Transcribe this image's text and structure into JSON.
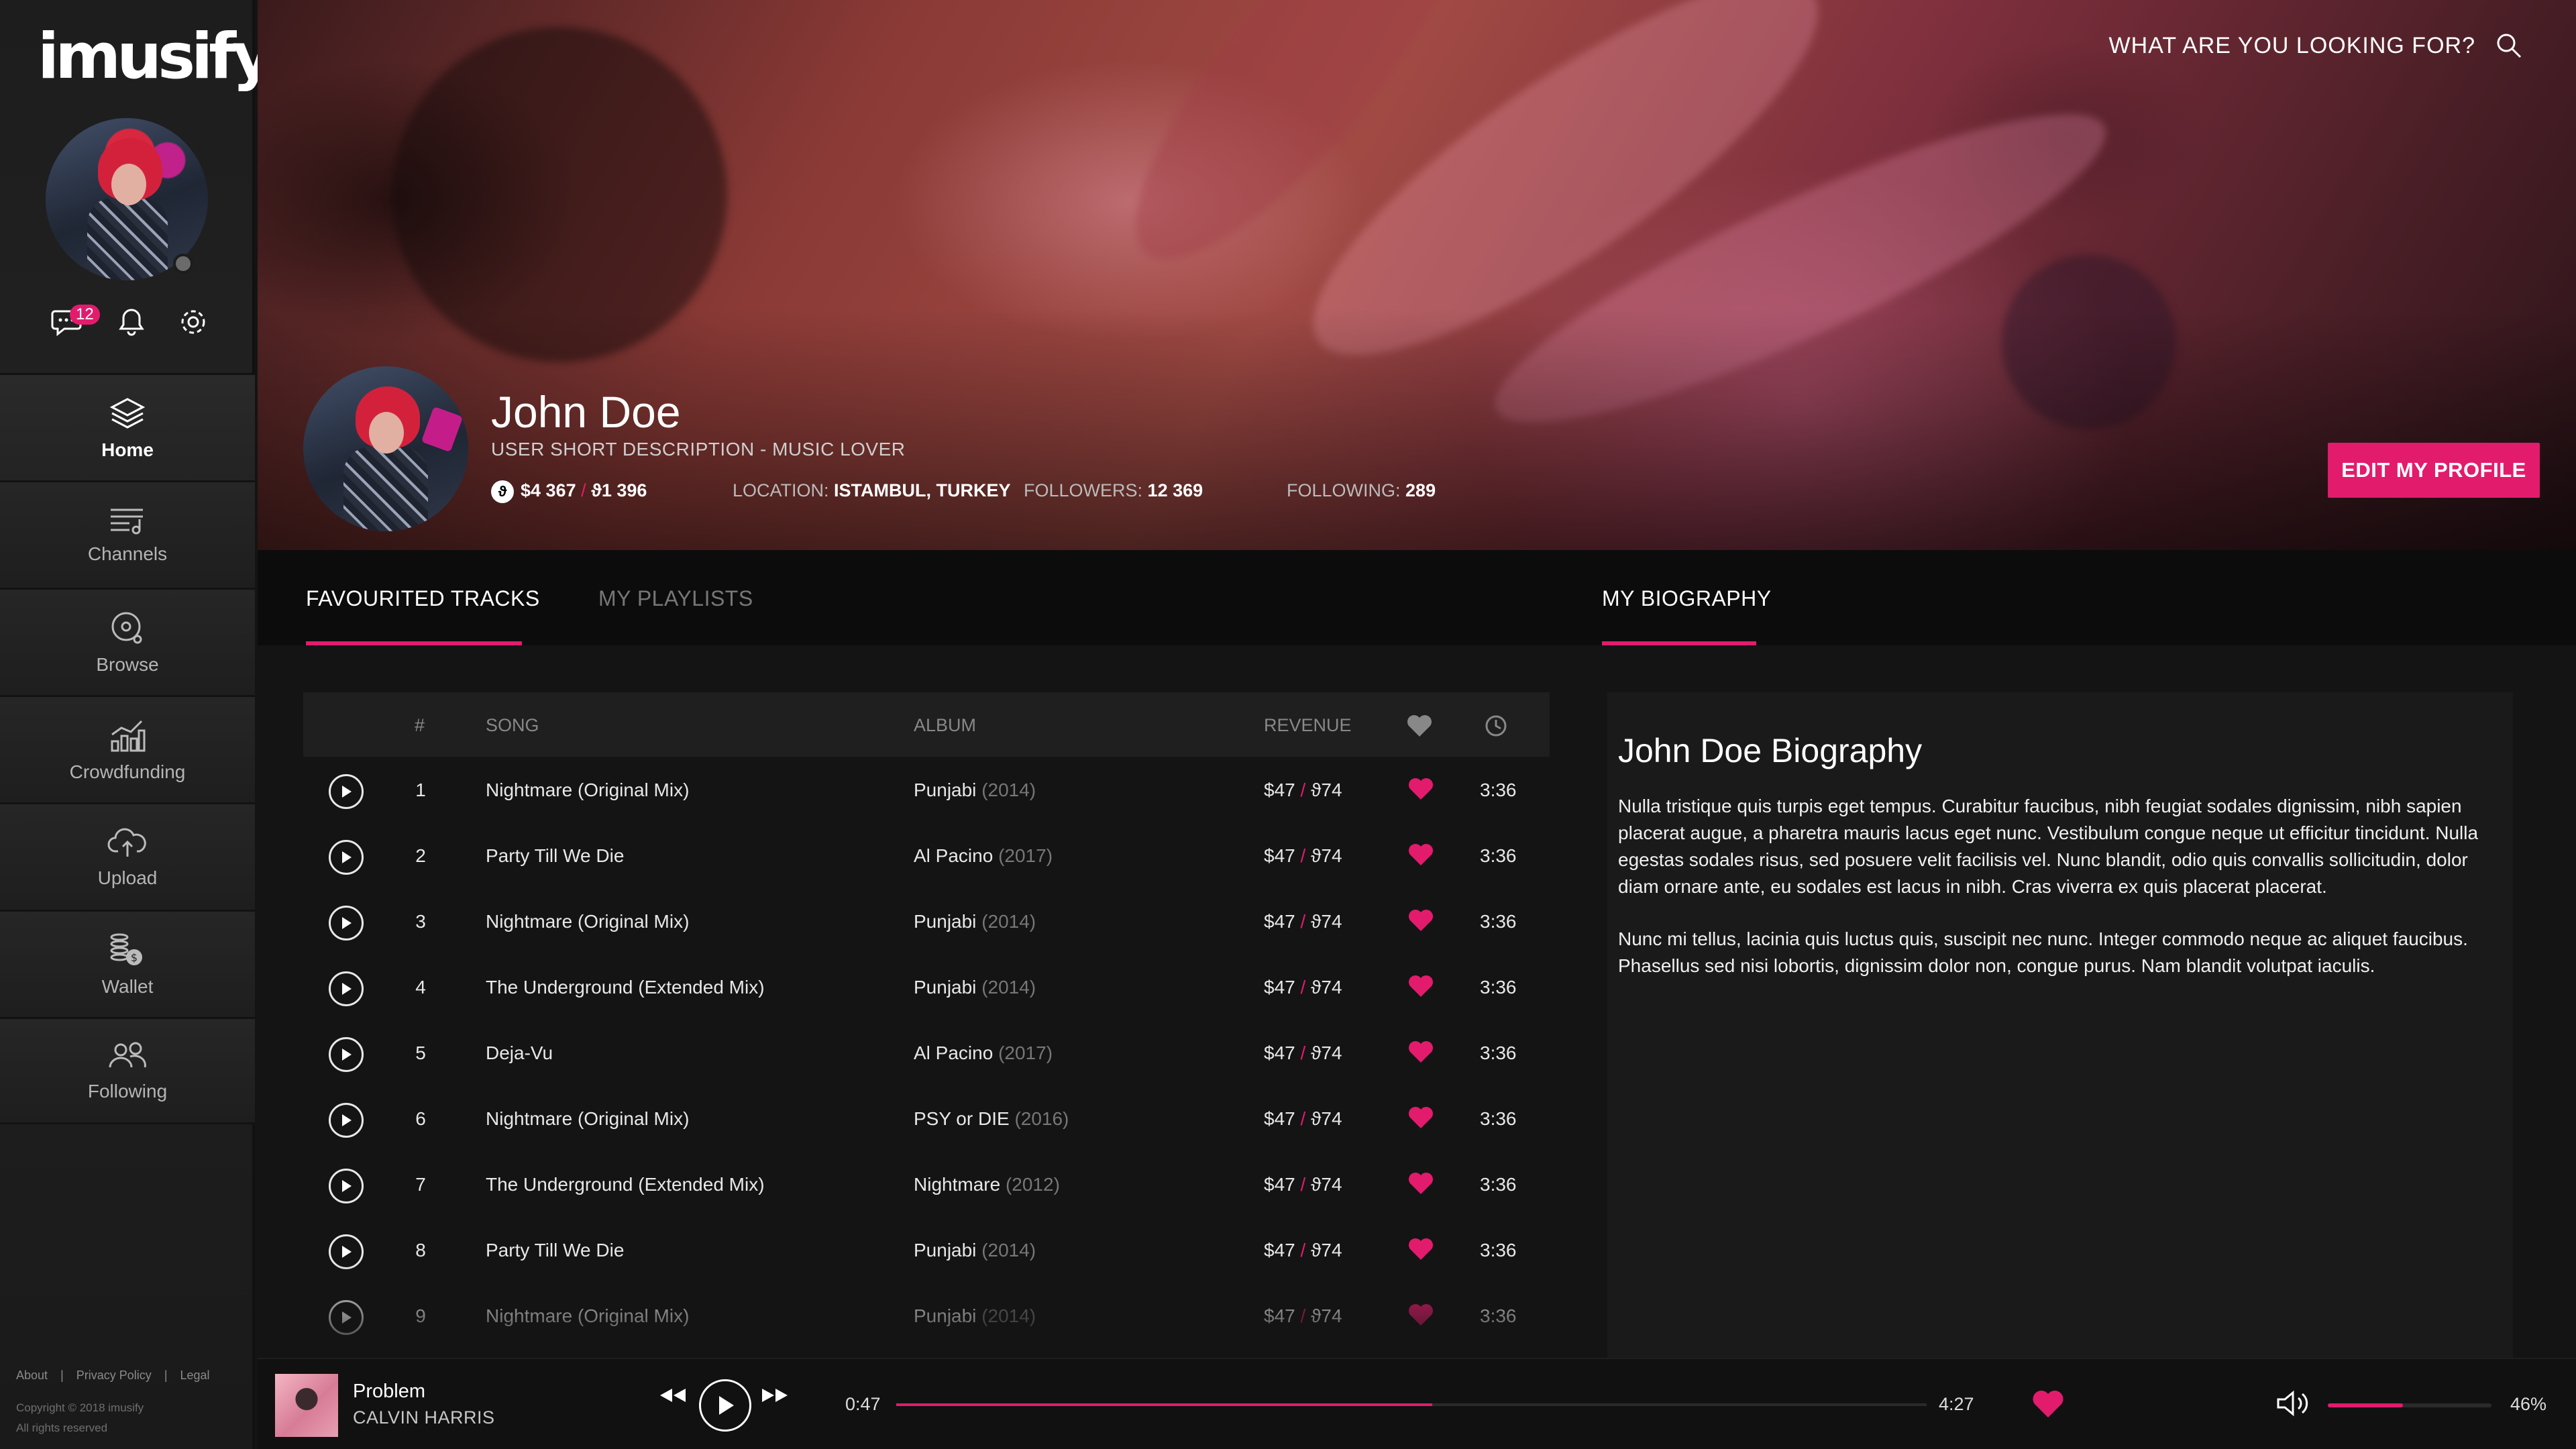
{
  "app": {
    "logo": "imusify."
  },
  "colors": {
    "accent": "#e31b6d",
    "background": "#141414",
    "sidebar": "#1f1f1f"
  },
  "sidebar": {
    "messages_badge": "12",
    "icons": [
      "chat-icon",
      "bell-icon",
      "gear-icon"
    ],
    "nav": [
      {
        "label": "Home",
        "icon": "layers-icon",
        "active": true
      },
      {
        "label": "Channels",
        "icon": "channels-icon"
      },
      {
        "label": "Browse",
        "icon": "browse-icon"
      },
      {
        "label": "Crowdfunding",
        "icon": "chart-icon"
      },
      {
        "label": "Upload",
        "icon": "cloud-upload-icon"
      },
      {
        "label": "Wallet",
        "icon": "wallet-icon"
      },
      {
        "label": "Following",
        "icon": "users-icon"
      }
    ],
    "footer": {
      "about": "About",
      "sep": "|",
      "privacy": "Privacy Policy",
      "legal": "Legal",
      "copyright": "Copyright © 2018 imusify",
      "rights": "All rights reserved"
    }
  },
  "header": {
    "search_label": "WHAT ARE YOU LOOKING FOR?"
  },
  "profile": {
    "name": "John Doe",
    "description": "USER SHORT DESCRIPTION - MUSIC LOVER",
    "balance_usd": "$4 367",
    "balance_sep": "/",
    "balance_token": "ϑ1 396",
    "location_label": "LOCATION:",
    "location": "ISTAMBUL, TURKEY",
    "followers_label": "FOLLOWERS:",
    "followers": "12 369",
    "following_label": "FOLLOWING:",
    "following": "289",
    "edit_button": "EDIT MY PROFILE"
  },
  "tabs": {
    "favourited": "FAVOURITED  TRACKS",
    "playlists": "MY PLAYLISTS",
    "biography": "MY BIOGRAPHY"
  },
  "table": {
    "headers": {
      "num": "#",
      "song": "SONG",
      "album": "ALBUM",
      "revenue": "REVENUE"
    },
    "rows": [
      {
        "num": "1",
        "song": "Nightmare (Original Mix)",
        "album": "Punjabi",
        "year": "(2014)",
        "rev": "$47",
        "token": "ϑ74",
        "time": "3:36"
      },
      {
        "num": "2",
        "song": "Party Till We Die",
        "album": "Al Pacino",
        "year": "(2017)",
        "rev": "$47",
        "token": "ϑ74",
        "time": "3:36"
      },
      {
        "num": "3",
        "song": "Nightmare (Original Mix)",
        "album": "Punjabi",
        "year": "(2014)",
        "rev": "$47",
        "token": "ϑ74",
        "time": "3:36"
      },
      {
        "num": "4",
        "song": "The Underground (Extended Mix)",
        "album": "Punjabi",
        "year": "(2014)",
        "rev": "$47",
        "token": "ϑ74",
        "time": "3:36"
      },
      {
        "num": "5",
        "song": "Deja-Vu",
        "album": "Al Pacino",
        "year": "(2017)",
        "rev": "$47",
        "token": "ϑ74",
        "time": "3:36"
      },
      {
        "num": "6",
        "song": "Nightmare (Original Mix)",
        "album": "PSY or DIE",
        "year": "(2016)",
        "rev": "$47",
        "token": "ϑ74",
        "time": "3:36"
      },
      {
        "num": "7",
        "song": "The Underground (Extended Mix)",
        "album": "Nightmare",
        "year": "(2012)",
        "rev": "$47",
        "token": "ϑ74",
        "time": "3:36"
      },
      {
        "num": "8",
        "song": "Party Till We Die",
        "album": "Punjabi",
        "year": "(2014)",
        "rev": "$47",
        "token": "ϑ74",
        "time": "3:36"
      },
      {
        "num": "9",
        "song": "Nightmare (Original Mix)",
        "album": "Punjabi",
        "year": "(2014)",
        "rev": "$47",
        "token": "ϑ74",
        "time": "3:36"
      }
    ]
  },
  "biography": {
    "title": "John Doe Biography",
    "p1": "Nulla tristique quis turpis eget tempus. Curabitur faucibus, nibh feugiat sodales dignissim, nibh sapien placerat augue, a pharetra mauris lacus eget nunc. Vestibulum congue neque ut efficitur tincidunt. Nulla egestas sodales risus, sed posuere velit facilisis vel. Nunc blandit, odio quis convallis sollicitudin, dolor diam ornare ante, eu sodales est lacus in nibh. Cras viverra ex quis placerat placerat.",
    "p2": "Nunc mi tellus, lacinia quis luctus quis, suscipit nec nunc. Integer commodo neque ac aliquet faucibus. Phasellus sed nisi lobortis, dignissim dolor non, congue purus. Nam blandit volutpat iaculis."
  },
  "player": {
    "title": "Problem",
    "artist": "CALVIN HARRIS",
    "current_time": "0:47",
    "total_time": "4:27",
    "progress_fraction": 0.52,
    "volume": "46%",
    "volume_fraction": 0.46
  }
}
